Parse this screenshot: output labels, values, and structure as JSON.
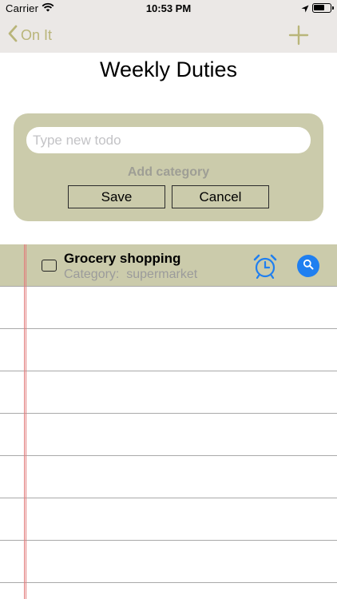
{
  "status_bar": {
    "carrier": "Carrier",
    "time": "10:53 PM",
    "battery_level": 0.7
  },
  "nav": {
    "back_label": "On It",
    "accent_color": "#b9b57a"
  },
  "page": {
    "title": "Weekly Duties"
  },
  "form": {
    "input_placeholder": "Type new todo",
    "input_value": "",
    "add_category_label": "Add category",
    "save_label": "Save",
    "cancel_label": "Cancel",
    "card_color": "#cbcbab"
  },
  "todos": [
    {
      "title": "Grocery shopping",
      "category_label": "Category:  supermarket",
      "done": false
    }
  ],
  "icons": {
    "back": "chevron-left-icon",
    "add": "plus-icon",
    "alarm": "alarm-clock-icon",
    "search": "search-icon"
  },
  "colors": {
    "action_blue": "#1f7ff0",
    "margin_red": "#e27a7a"
  }
}
